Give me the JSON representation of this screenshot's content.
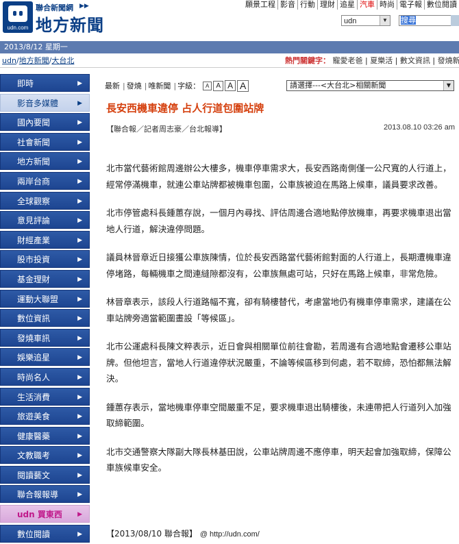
{
  "header": {
    "logo_domain": "udn.com",
    "brand_top": "聯合新聞網",
    "brand_main": "地方新聞",
    "topnav": [
      "願景工程",
      "影音",
      "行動",
      "理財",
      "追星",
      "汽車",
      "時尚",
      "電子報",
      "數位閱讀"
    ],
    "search_scope": "udn",
    "search_value": "搜尋"
  },
  "datebar": {
    "date": "2013/8/12 星期一"
  },
  "breadcrumb": {
    "items": [
      "udn",
      "地方新聞",
      "大台北"
    ],
    "sep": "/"
  },
  "hotkeys": {
    "label": "熱門關鍵字：",
    "items": [
      "寵愛老爸",
      "夏樂活",
      "數文資訊",
      "發燒新聞"
    ]
  },
  "sidebar": {
    "items": [
      {
        "label": "即時"
      },
      {
        "label": "影音多媒體"
      },
      {
        "label": "國內要聞"
      },
      {
        "label": "社會新聞"
      },
      {
        "label": "地方新聞"
      },
      {
        "label": "兩岸台商"
      },
      {
        "label": "全球觀察"
      },
      {
        "label": "意見評論"
      },
      {
        "label": "財經產業"
      },
      {
        "label": "股市投資"
      },
      {
        "label": "基金理財"
      },
      {
        "label": "運動大聯盟"
      },
      {
        "label": "數位資訊"
      },
      {
        "label": "發燒車訊"
      },
      {
        "label": "娛樂追星"
      },
      {
        "label": "時尚名人"
      },
      {
        "label": "生活消費"
      },
      {
        "label": "旅遊美食"
      },
      {
        "label": "健康醫藥"
      },
      {
        "label": "文教職考"
      },
      {
        "label": "閱讀藝文"
      },
      {
        "label": "聯合報報導"
      },
      {
        "label": "udn 買東西"
      },
      {
        "label": "數位閱讀"
      }
    ]
  },
  "toolbar": {
    "items": [
      "最新",
      "發燒",
      "唯新聞",
      "字級："
    ],
    "font_sizes": [
      "A",
      "A",
      "A",
      "A"
    ],
    "related_select": "請選擇---<大台北>相關新聞"
  },
  "article": {
    "headline": "長安西機車違停 占人行道包圍站牌",
    "byline": "【聯合報／記者周志豪／台北報導】",
    "date": "2013.08.10 03:26 am",
    "paragraphs": [
      "北市當代藝術館周邊辦公大樓多，機車停車需求大，長安西路南側僅一公尺寬的人行道上，經常停滿機車，就連公車站牌都被機車包圍，公車族被迫在馬路上候車，議員要求改善。",
      "北市停管處科長鍾蕙存說，一個月內尋找、評估周邊合適地點停放機車，再要求機車退出當地人行道，解決違停問題。",
      "議員林晉章近日接獲公車族陳情，位於長安西路當代藝術館對面的人行道上，長期遭機車違停堵路，每輛機車之間連縫隙都沒有，公車族無處可站，只好在馬路上候車，非常危險。",
      "林晉章表示，該段人行道路幅不寬，卻有騎樓替代，考慮當地仍有機車停車需求，建議在公車站牌旁適當範圍畫設「等候區」。",
      "北市公運處科長陳文粹表示，近日會與相關單位前往會勘，若周邊有合適地點會遷移公車站牌。但他坦言，當地人行道違停狀況嚴重，不論等候區移到何處，若不取締，恐怕都無法解決。",
      "鍾蕙存表示，當地機車停車空間嚴重不足，要求機車退出騎樓後，未連帶把人行道列入加強取締範圍。",
      "北市交通警察大隊副大隊長林基田說，公車站牌周邊不應停車，明天起會加強取締，保障公車族候車安全。"
    ],
    "source": "【2013/08/10 聯合報】",
    "source_url": "@ http://udn.com/"
  },
  "colors": {
    "brand_blue": "#0b3f86",
    "datebar": "#5d7bb0",
    "headline": "#d5400e",
    "nav_blue": "#1d4591"
  }
}
